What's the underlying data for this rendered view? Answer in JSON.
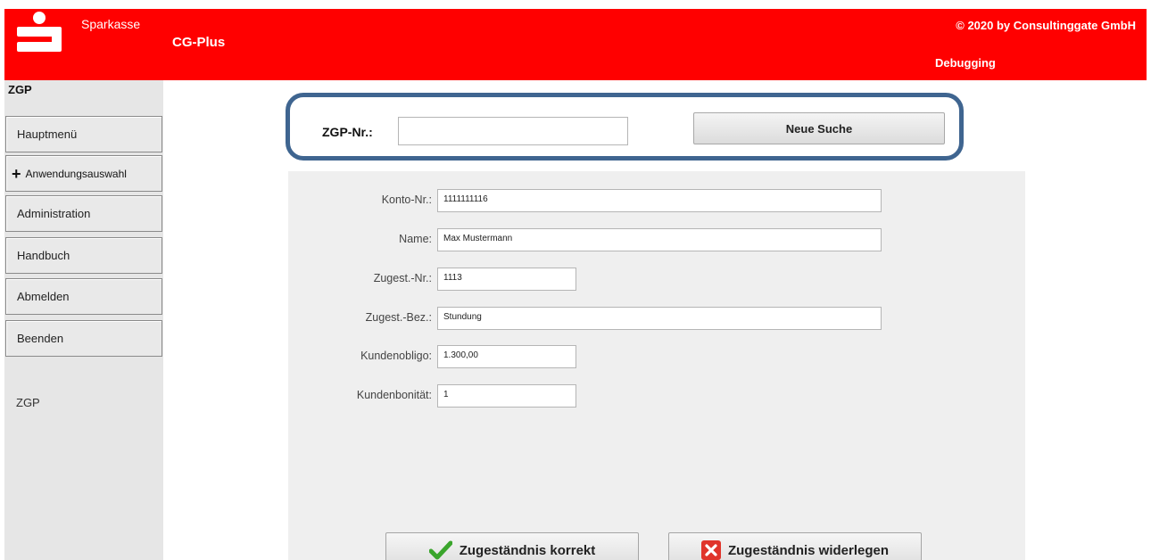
{
  "header": {
    "brand": "Sparkasse",
    "app_title": "CG-Plus",
    "copyright": "© 2020 by Consultinggate GmbH",
    "debug_label": "Debugging",
    "color": "#ff0000"
  },
  "sidebar": {
    "title": "ZGP",
    "items": [
      {
        "label": "Hauptmenü"
      },
      {
        "label": "Anwendungsauswahl"
      },
      {
        "label": "Administration"
      },
      {
        "label": "Handbuch"
      },
      {
        "label": "Abmelden"
      },
      {
        "label": "Beenden"
      }
    ],
    "section_label": "ZGP"
  },
  "search": {
    "label": "ZGP-Nr.:",
    "value": "",
    "button_label": "Neue Suche",
    "border_color": "#3f6590"
  },
  "form": {
    "fields": [
      {
        "label": "Konto-Nr.:",
        "value": "1111111116"
      },
      {
        "label": "Name:",
        "value": "Max Mustermann"
      },
      {
        "label": "Zugest.-Nr.:",
        "value": "1113"
      },
      {
        "label": "Zugest.-Bez.:",
        "value": "Stundung"
      },
      {
        "label": "Kundenobligo:",
        "value": "1.300,00"
      },
      {
        "label": "Kundenbonität:",
        "value": "1"
      }
    ]
  },
  "actions": {
    "confirm_label": "Zugeständnis korrekt",
    "reject_label": "Zugeständnis widerlegen",
    "confirm_icon": "checkmark-icon",
    "reject_icon": "red-x-icon"
  }
}
